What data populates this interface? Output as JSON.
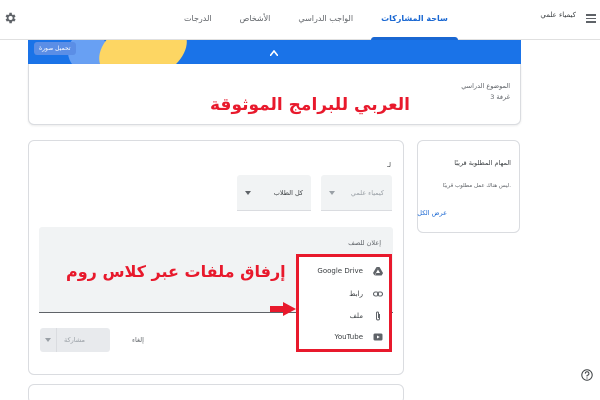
{
  "header": {
    "class_title": "كيمياء علمي",
    "tabs": [
      {
        "label": "ساحة المشاركات",
        "active": true
      },
      {
        "label": "الواجب الدراسي",
        "active": false
      },
      {
        "label": "الأشخاص",
        "active": false
      },
      {
        "label": "الدرجات",
        "active": false
      }
    ]
  },
  "banner": {
    "upload_photo_label": "تحميل صورة",
    "subject_label": "الموضوع الدراسي",
    "room_label": "غرفة 3",
    "red_caption": "العربي للبرامج الموثوقة"
  },
  "upcoming": {
    "title": "المهام المطلوبة قريبًا",
    "body": "ليس هناك عمل مطلوب قريبًا.",
    "view_all_label": "عرض الكل"
  },
  "announce": {
    "for_label": "لـ",
    "class_select_value": "كيمياء علمي",
    "students_select_value": "كل الطلاب",
    "placeholder": "إعلان للصف",
    "red_caption": "إرفاق ملفات عبر كلاس روم",
    "attachments": [
      {
        "label": "Google Drive",
        "icon": "google-drive-icon"
      },
      {
        "label": "رابط",
        "icon": "link-icon"
      },
      {
        "label": "ملف",
        "icon": "paperclip-icon"
      },
      {
        "label": "YouTube",
        "icon": "youtube-icon"
      }
    ],
    "cancel_label": "إلغاء",
    "post_label": "مشاركة"
  },
  "colors": {
    "accent": "#1967d2",
    "banner": "#1a73e8",
    "highlight": "#e8192c"
  }
}
